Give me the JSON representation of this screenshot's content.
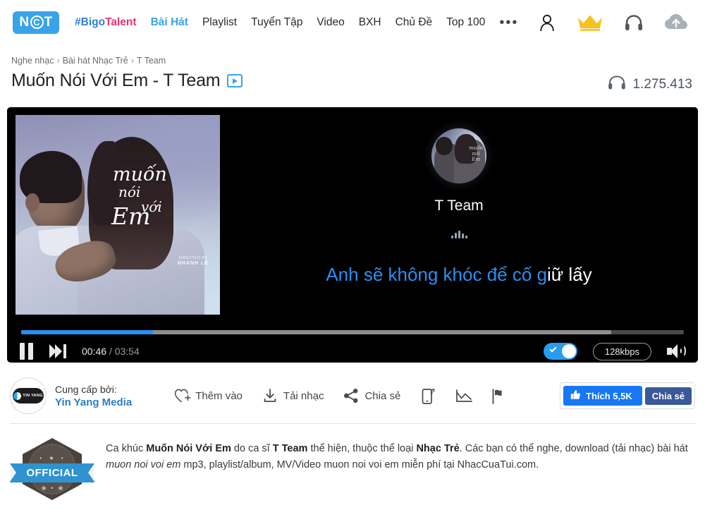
{
  "header": {
    "logo": {
      "part1": "N",
      "part2": "C",
      "part3": "T"
    },
    "nav": [
      {
        "label": "#BigoTalent",
        "style": "bigo"
      },
      {
        "label": "Bài Hát",
        "style": "active"
      },
      {
        "label": "Playlist",
        "style": "normal"
      },
      {
        "label": "Tuyển Tập",
        "style": "normal"
      },
      {
        "label": "Video",
        "style": "normal"
      },
      {
        "label": "BXH",
        "style": "normal"
      },
      {
        "label": "Chủ Đề",
        "style": "normal"
      },
      {
        "label": "Top 100",
        "style": "normal"
      }
    ],
    "more_label": "•••",
    "icons": [
      {
        "name": "user-icon",
        "label": "Tài khoản"
      },
      {
        "name": "crown-icon",
        "label": "VIP"
      },
      {
        "name": "headphone-icon",
        "label": "Nghe"
      },
      {
        "name": "upload-cloud-icon",
        "label": "Tải lên"
      }
    ],
    "accent_color": "#3aa3e8",
    "crown_color": "#f5c31e"
  },
  "breadcrumb": {
    "items": [
      "Nghe nhạc",
      "Bài hát Nhạc Trẻ",
      "T Team"
    ],
    "separator": "›"
  },
  "title": {
    "text": "Muốn Nói Với Em - T Team",
    "mv_badge": "video-badge"
  },
  "listen": {
    "icon": "headphone-icon",
    "count": "1.275.413"
  },
  "player": {
    "artwork": {
      "script_line1": "muốn",
      "script_line2": "nói",
      "script_line3": "với",
      "script_line4": "Em",
      "credit_small": "DIRECTED BY",
      "credit_name": "NHANH LÊ"
    },
    "artist_name": "T Team",
    "lyric": {
      "sung": "Anh sẽ không khóc để cố g",
      "unsung": "iữ lấy"
    },
    "progress": {
      "played_percent": 19.9,
      "buffered_percent": 89,
      "played_color": "#2a8ff0"
    },
    "controls": {
      "pause_label": "Tạm dừng",
      "next_label": "Bài tiếp",
      "current_time": "00:46",
      "time_separator": "/",
      "total_time": "03:54",
      "toggle_label": "Bật lời bài hát",
      "toggle_on": true,
      "bitrate": "128kbps",
      "volume_label": "Âm lượng"
    }
  },
  "provider": {
    "caption": "Cung cấp bởi:",
    "name": "Yin Yang Media",
    "logo_text": "YIN YANG"
  },
  "actions": [
    {
      "icon": "heart-plus-icon",
      "label": "Thêm vào"
    },
    {
      "icon": "download-icon",
      "label": "Tải nhạc"
    },
    {
      "icon": "share-icon",
      "label": "Chia sẻ"
    },
    {
      "icon": "mobile-ringtone-icon",
      "label": ""
    },
    {
      "icon": "chart-icon",
      "label": ""
    },
    {
      "icon": "flag-report-icon",
      "label": ""
    }
  ],
  "facebook": {
    "like_label": "Thích 5,5K",
    "like_icon": "thumbs-up-icon",
    "share_label": "Chia sẻ",
    "like_color": "#1877f2",
    "share_color": "#3b5998"
  },
  "description": {
    "badge_label": "OFFICIAL",
    "seg1": "Ca khúc ",
    "song": "Muốn Nói Với Em",
    "seg2": " do ca sĩ ",
    "artist": "T Team",
    "seg3": " thể hiện, thuộc thể loại ",
    "genre": "Nhạc Trẻ",
    "seg4": ". Các bạn có thể nghe, download (tải nhạc) bài hát ",
    "italic": "muon noi voi em",
    "seg5": " mp3, playlist/album, MV/Video muon noi voi em miễn phí tại NhacCuaTui.com."
  }
}
